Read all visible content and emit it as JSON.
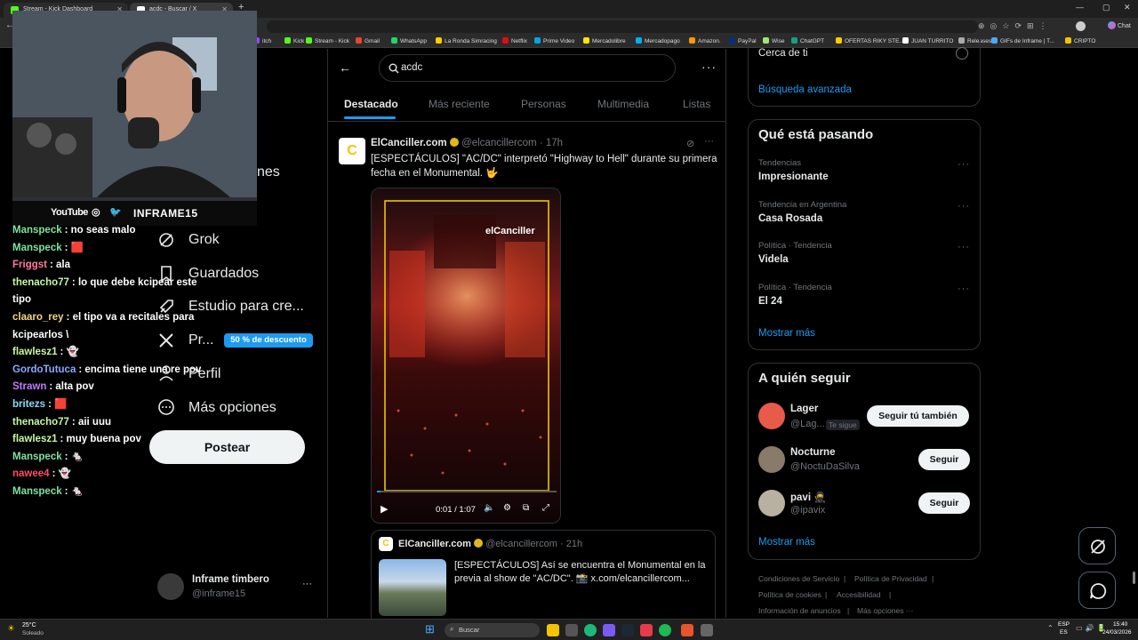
{
  "browser": {
    "tabs": [
      {
        "title": "Stream - Kick Dashboard",
        "color": "#53fc18"
      },
      {
        "title": "acdc - Buscar / X",
        "color": "#ffffff"
      }
    ],
    "bookmarks": [
      "itch",
      "Kick",
      "Stream - Kick",
      "Gmail",
      "WhatsApp",
      "La Ronda Simracing",
      "Netflix",
      "Prime Video",
      "Mercadolibre",
      "Mercadopago",
      "Amazon.",
      "PayPal",
      "Wise",
      "ChatGPT",
      "OFERTAS RIKY STE...",
      "JUAN TURRITO",
      "Releases",
      "GIFs de Inframe | T...",
      "CRIPTO"
    ],
    "chat_label": "Chat"
  },
  "webcam": {
    "socials": [
      "YouTube",
      "INFRAME15"
    ]
  },
  "chat": [
    {
      "user": "Manspeck",
      "color": "#7fe3a0",
      "msg": ": no seas malo"
    },
    {
      "user": "Manspeck",
      "color": "#7fe3a0",
      "msg": ": 🟥"
    },
    {
      "user": "Friggst",
      "color": "#ff7aa0",
      "msg": ": ala"
    },
    {
      "user": "thenacho77",
      "color": "#c8f7a0",
      "msg": ": lo que debe kcipear este tipo"
    },
    {
      "user": "claaro_rey",
      "color": "#f5d48a",
      "msg": ": el tipo va a recitales para kcipearlos \\"
    },
    {
      "user": "flawlesz1",
      "color": "#c8f7a0",
      "msg": ": 👻"
    },
    {
      "user": "GordoTutuca",
      "color": "#8aa8ff",
      "msg": ": encima tiene una re pov"
    },
    {
      "user": "Strawn",
      "color": "#c07aff",
      "msg": ": alta pov"
    },
    {
      "user": "britezs",
      "color": "#8ad8ff",
      "msg": ": 🟥"
    },
    {
      "user": "thenacho77",
      "color": "#c8f7a0",
      "msg": ": aii uuu"
    },
    {
      "user": "flawlesz1",
      "color": "#c8f7a0",
      "msg": ": muy buena pov"
    },
    {
      "user": "Manspeck",
      "color": "#7fe3a0",
      "msg": ": 🐁"
    },
    {
      "user": "nawee4",
      "color": "#ff4a6a",
      "msg": ": 👻"
    },
    {
      "user": "Manspeck",
      "color": "#7fe3a0",
      "msg": ": 🐁"
    }
  ],
  "sidebar": {
    "items": [
      {
        "label": "nes",
        "icon": "notifications-icon"
      },
      {
        "label": "Grok",
        "icon": "grok-icon"
      },
      {
        "label": "Guardados",
        "icon": "bookmark-icon"
      },
      {
        "label": "Estudio para cre...",
        "icon": "rocket-icon"
      },
      {
        "label": "Pr...",
        "icon": "x-logo-icon"
      },
      {
        "label": "Perfil",
        "icon": "person-icon"
      },
      {
        "label": "Más opciones",
        "icon": "more-circle-icon"
      }
    ],
    "discount_badge": "50 % de descuento",
    "post_button": "Postear",
    "account": {
      "name": "Inframe timbero",
      "handle": "@inframe15"
    }
  },
  "search": {
    "query": "acdc",
    "tabs": [
      "Destacado",
      "Más reciente",
      "Personas",
      "Multimedia",
      "Listas"
    ],
    "active_tab": "Destacado"
  },
  "tweet": {
    "name": "ElCanciller.com",
    "handle": "@elcancillercom",
    "time": "· 17h",
    "text": "[ESPECTÁCULOS] \"AC/DC\" interpretó \"Highway to Hell\" durante su primera fecha en el Monumental. 🤟",
    "video_brand": "elCanciller",
    "video_time": "0:01 / 1:07",
    "video_progress": 0.02
  },
  "quote": {
    "name": "ElCanciller.com",
    "handle": "@elcancillercom",
    "time": "· 21h",
    "text": "[ESPECTÁCULOS] Así se encuentra el Monumental en la previa al show de \"AC/DC\". 📸 x.com/elcancillercom..."
  },
  "right": {
    "near_you": "Cerca de ti",
    "advanced_search": "Búsqueda avanzada",
    "trends_title": "Qué está pasando",
    "trends": [
      {
        "meta": "Tendencias",
        "name": "Impresionante"
      },
      {
        "meta": "Tendencia en Argentina",
        "name": "Casa Rosada"
      },
      {
        "meta": "Política · Tendencia",
        "name": "Videla"
      },
      {
        "meta": "Política · Tendencia",
        "name": "El 24"
      }
    ],
    "show_more": "Mostrar más",
    "follow_title": "A quién seguir",
    "follow": [
      {
        "name": "Lager",
        "handle": "@Lag...",
        "badge": "Te sigue",
        "button": "Seguir tú también"
      },
      {
        "name": "Nocturne",
        "handle": "@NoctuDaSilva",
        "button": "Seguir"
      },
      {
        "name": "pavi 🥷",
        "handle": "@ipavix",
        "button": "Seguir"
      }
    ],
    "show_more_follow": "Mostrar más",
    "footer": [
      "Condiciones de Servicio",
      "|",
      "Política de Privacidad",
      "|",
      "Política de cookies",
      "|",
      "Accesibilidad",
      "|",
      "Información de anuncios",
      "|",
      "Más opciones ···"
    ]
  },
  "taskbar": {
    "weather_temp": "25°C",
    "weather_text": "Soleado",
    "search_placeholder": "Buscar",
    "lang": "ESP",
    "lang2": "ES",
    "time": "15:40",
    "date": "24/03/2026"
  }
}
